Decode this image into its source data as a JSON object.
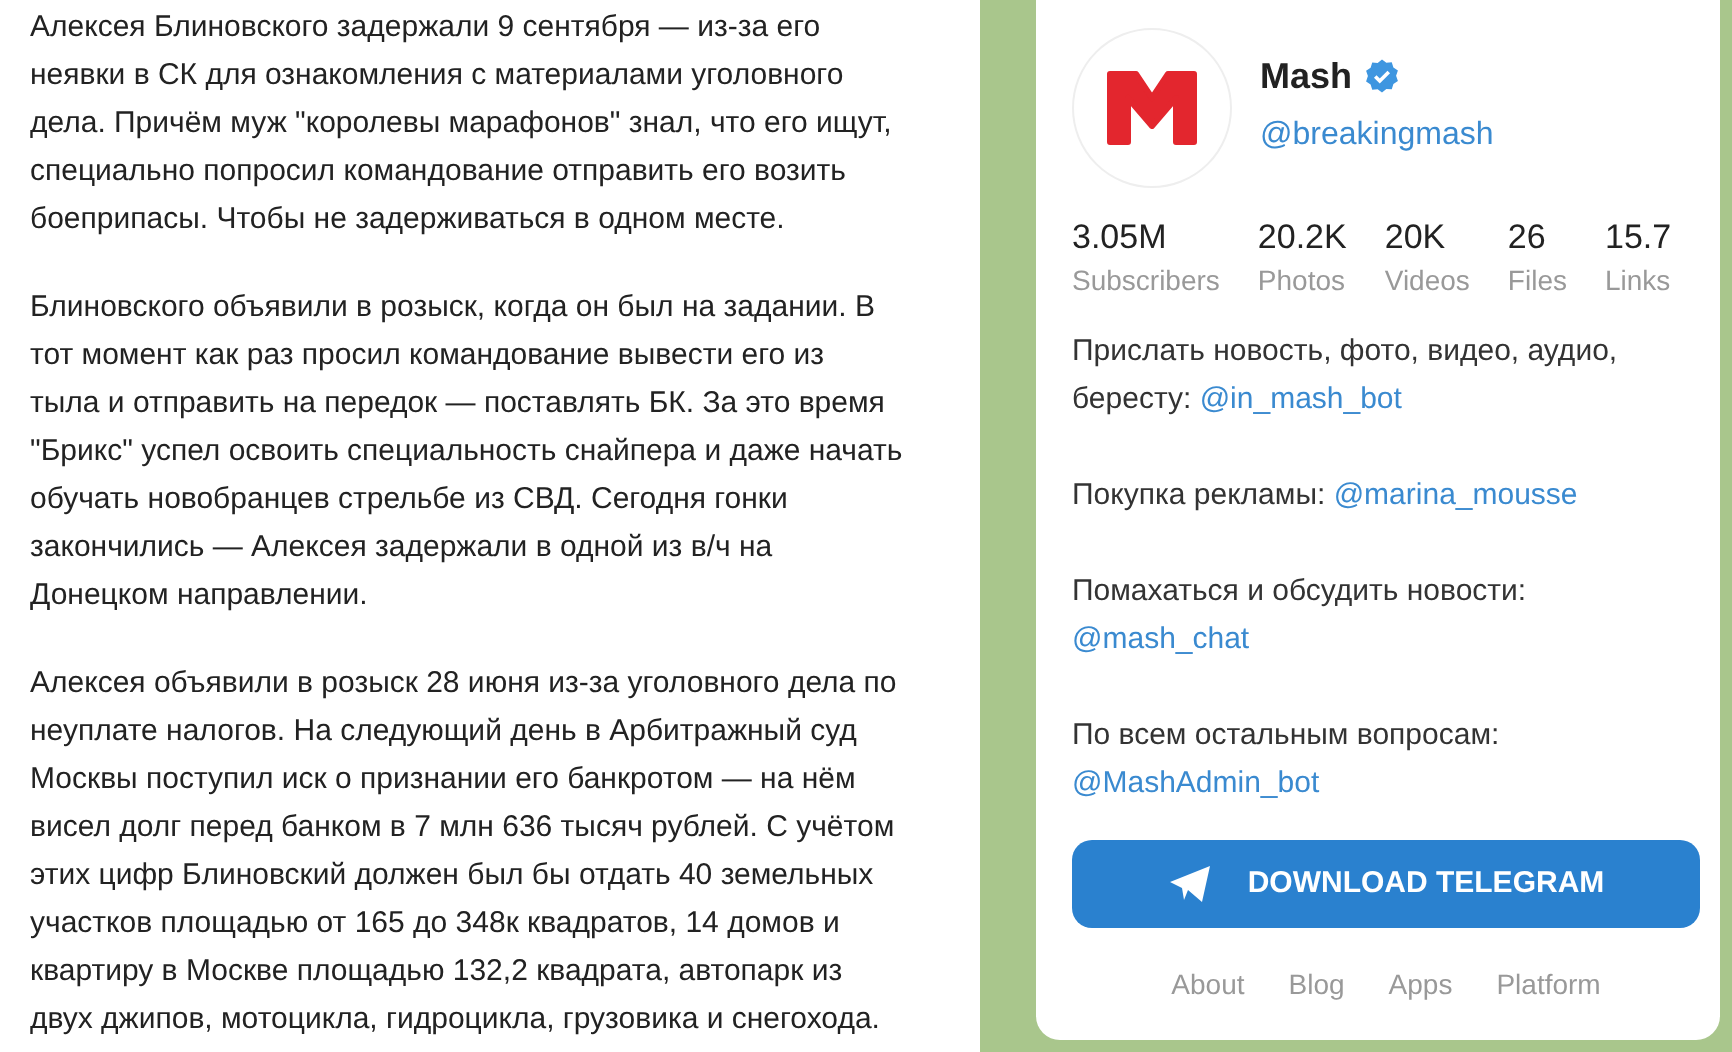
{
  "article": {
    "paragraphs": [
      {
        "lines": [
          "Алексея Блиновского задержали 9 сентября — из-за его",
          "неявки в СК для ознакомления с материалами уголовного",
          "дела. Причём муж \"королевы марафонов\" знал, что его ищут,",
          "специально попросил командование отправить его возить",
          "боеприпасы. Чтобы не задерживаться в одном месте."
        ]
      },
      {
        "lines": [
          "Блиновского объявили в розыск, когда он был на задании. В",
          "тот момент как раз просил командование вывести его из",
          "тыла и отправить на передок — поставлять БК. За это время",
          "\"Брикс\" успел освоить специальность снайпера и даже начать",
          "обучать новобранцев стрельбе из СВД. Сегодня гонки",
          "закончились — Алексея задержали в одной из в/ч на",
          "Донецком направлении."
        ]
      },
      {
        "lines": [
          "Алексея объявили в розыск 28 июня из-за уголовного дела по",
          "неуплате налогов. На следующий день в Арбитражный суд",
          "Москвы поступил иск о признании его банкротом — на нём",
          "висел долг перед банком в 7 млн 636 тысяч рублей. С учётом",
          "этих цифр Блиновский должен был бы отдать 40 земельных",
          "участков площадью от 165 до 348к квадратов, 14 домов и",
          "квартиру в Москве площадью 132,2 квадрата, автопарк из",
          "двух джипов, мотоцикла, гидроцикла, грузовика и снегохода."
        ]
      }
    ]
  },
  "channel": {
    "name": "Mash",
    "verified": true,
    "handle": "@breakingmash",
    "stats": [
      {
        "value": "3.05M",
        "label": "Subscribers"
      },
      {
        "value": "20.2K",
        "label": "Photos"
      },
      {
        "value": "20K",
        "label": "Videos"
      },
      {
        "value": "26",
        "label": "Files"
      },
      {
        "value": "15.7",
        "label": "Links"
      }
    ],
    "description": [
      {
        "lines": [
          "Прислать новость, фото, видео, аудио,"
        ],
        "last": "бересту: ",
        "link": "@in_mash_bot"
      },
      {
        "last": "Покупка рекламы: ",
        "link": "@marina_mousse"
      },
      {
        "lines": [
          "Помахаться и обсудить новости:"
        ],
        "link": "@mash_chat"
      },
      {
        "lines": [
          "По всем остальным вопросам:"
        ],
        "link": "@MashAdmin_bot"
      }
    ],
    "button": "DOWNLOAD TELEGRAM",
    "footer": [
      "About",
      "Blog",
      "Apps",
      "Platform"
    ]
  }
}
